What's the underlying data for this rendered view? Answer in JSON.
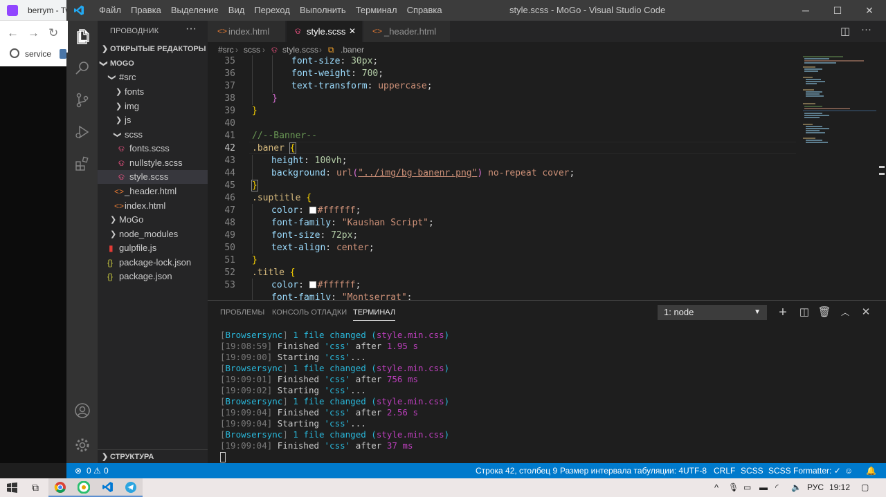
{
  "browser": {
    "tab_title": "berrym - Tw",
    "bookmark": "service"
  },
  "titlebar": {
    "menu": [
      "Файл",
      "Правка",
      "Выделение",
      "Вид",
      "Переход",
      "Выполнить",
      "Терминал",
      "Справка"
    ],
    "title": "style.scss - MoGo - Visual Studio Code"
  },
  "sidebar": {
    "header": "ПРОВОДНИК",
    "open_editors": "ОТКРЫТЫЕ РЕДАКТОРЫ",
    "root": "MOGO",
    "items": [
      "#src",
      "fonts",
      "img",
      "js",
      "scss",
      "fonts.scss",
      "nullstyle.scss",
      "style.scss",
      "_header.html",
      "index.html",
      "MoGo",
      "node_modules",
      "gulpfile.js",
      "package-lock.json",
      "package.json"
    ],
    "outline": "СТРУКТУРА"
  },
  "tabs": [
    "index.html",
    "style.scss",
    "_header.html"
  ],
  "breadcrumbs": [
    "#src",
    "scss",
    "style.scss",
    ".baner"
  ],
  "code": {
    "line_numbers": [
      "35",
      "36",
      "37",
      "38",
      "39",
      "40",
      "41",
      "42",
      "43",
      "44",
      "45",
      "46",
      "47",
      "48",
      "49",
      "50",
      "51",
      "52",
      "53"
    ],
    "lines": {
      "l35_p": "font-size",
      "l35_v": "30px",
      "l36_p": "font-weight",
      "l36_v": "700",
      "l37_p": "text-transform",
      "l37_v": "uppercase",
      "l41": "//--Banner--",
      "l42": ".baner",
      "l43_p": "height",
      "l43_v": "100vh",
      "l44_p": "background",
      "l44_fn": "url",
      "l44_str": "\"../img/bg-banenr.png\"",
      "l44_rest": "no-repeat cover",
      "l46": ".suptitle",
      "l47_p": "color",
      "l47_v": "#ffffff",
      "l48_p": "font-family",
      "l48_v": "\"Kaushan Script\"",
      "l49_p": "font-size",
      "l49_v": "72px",
      "l50_p": "text-align",
      "l50_v": "center",
      "l52": ".title",
      "l53_p": "color",
      "l53_v": "#ffffff",
      "l54_p": "font-family",
      "l54_v": "\"Montserrat\""
    }
  },
  "panel": {
    "tabs": [
      "ПРОБЛЕМЫ",
      "КОНСОЛЬ ОТЛАДКИ",
      "ТЕРМИНАЛ"
    ],
    "terminal_select": "1: node",
    "terminal": [
      {
        "a": "[",
        "b": "Browsersync",
        "c": "] ",
        "d": "1 file changed (",
        "e": "style.min.css",
        "f": ")"
      },
      {
        "t": "[19:08:59]",
        "m": " Finished ",
        "q": "'css'",
        "r": " after ",
        "n": "1.95 s"
      },
      {
        "t": "[19:09:00]",
        "m": " Starting ",
        "q": "'css'",
        "r": "...",
        "n": ""
      },
      {
        "a": "[",
        "b": "Browsersync",
        "c": "] ",
        "d": "1 file changed (",
        "e": "style.min.css",
        "f": ")"
      },
      {
        "t": "[19:09:01]",
        "m": " Finished ",
        "q": "'css'",
        "r": " after ",
        "n": "756 ms"
      },
      {
        "t": "[19:09:02]",
        "m": " Starting ",
        "q": "'css'",
        "r": "...",
        "n": ""
      },
      {
        "a": "[",
        "b": "Browsersync",
        "c": "] ",
        "d": "1 file changed (",
        "e": "style.min.css",
        "f": ")"
      },
      {
        "t": "[19:09:04]",
        "m": " Finished ",
        "q": "'css'",
        "r": " after ",
        "n": "2.56 s"
      },
      {
        "t": "[19:09:04]",
        "m": " Starting ",
        "q": "'css'",
        "r": "...",
        "n": ""
      },
      {
        "a": "[",
        "b": "Browsersync",
        "c": "] ",
        "d": "1 file changed (",
        "e": "style.min.css",
        "f": ")"
      },
      {
        "t": "[19:09:04]",
        "m": " Finished ",
        "q": "'css'",
        "r": " after ",
        "n": "37 ms"
      }
    ]
  },
  "status": {
    "errors": "0",
    "warnings": "0",
    "position": "Строка 42, столбец 9",
    "tabsize": "Размер интервала табуляции: 4",
    "encoding": "UTF-8",
    "eol": "CRLF",
    "lang": "SCSS",
    "formatter": "SCSS Formatter: ✓"
  },
  "taskbar": {
    "lang": "РУС",
    "time": "19:12"
  },
  "colors": {
    "accent": "#007acc",
    "editor_bg": "#1e1e1e",
    "sidebar_bg": "#252526",
    "activity_bg": "#333333"
  }
}
